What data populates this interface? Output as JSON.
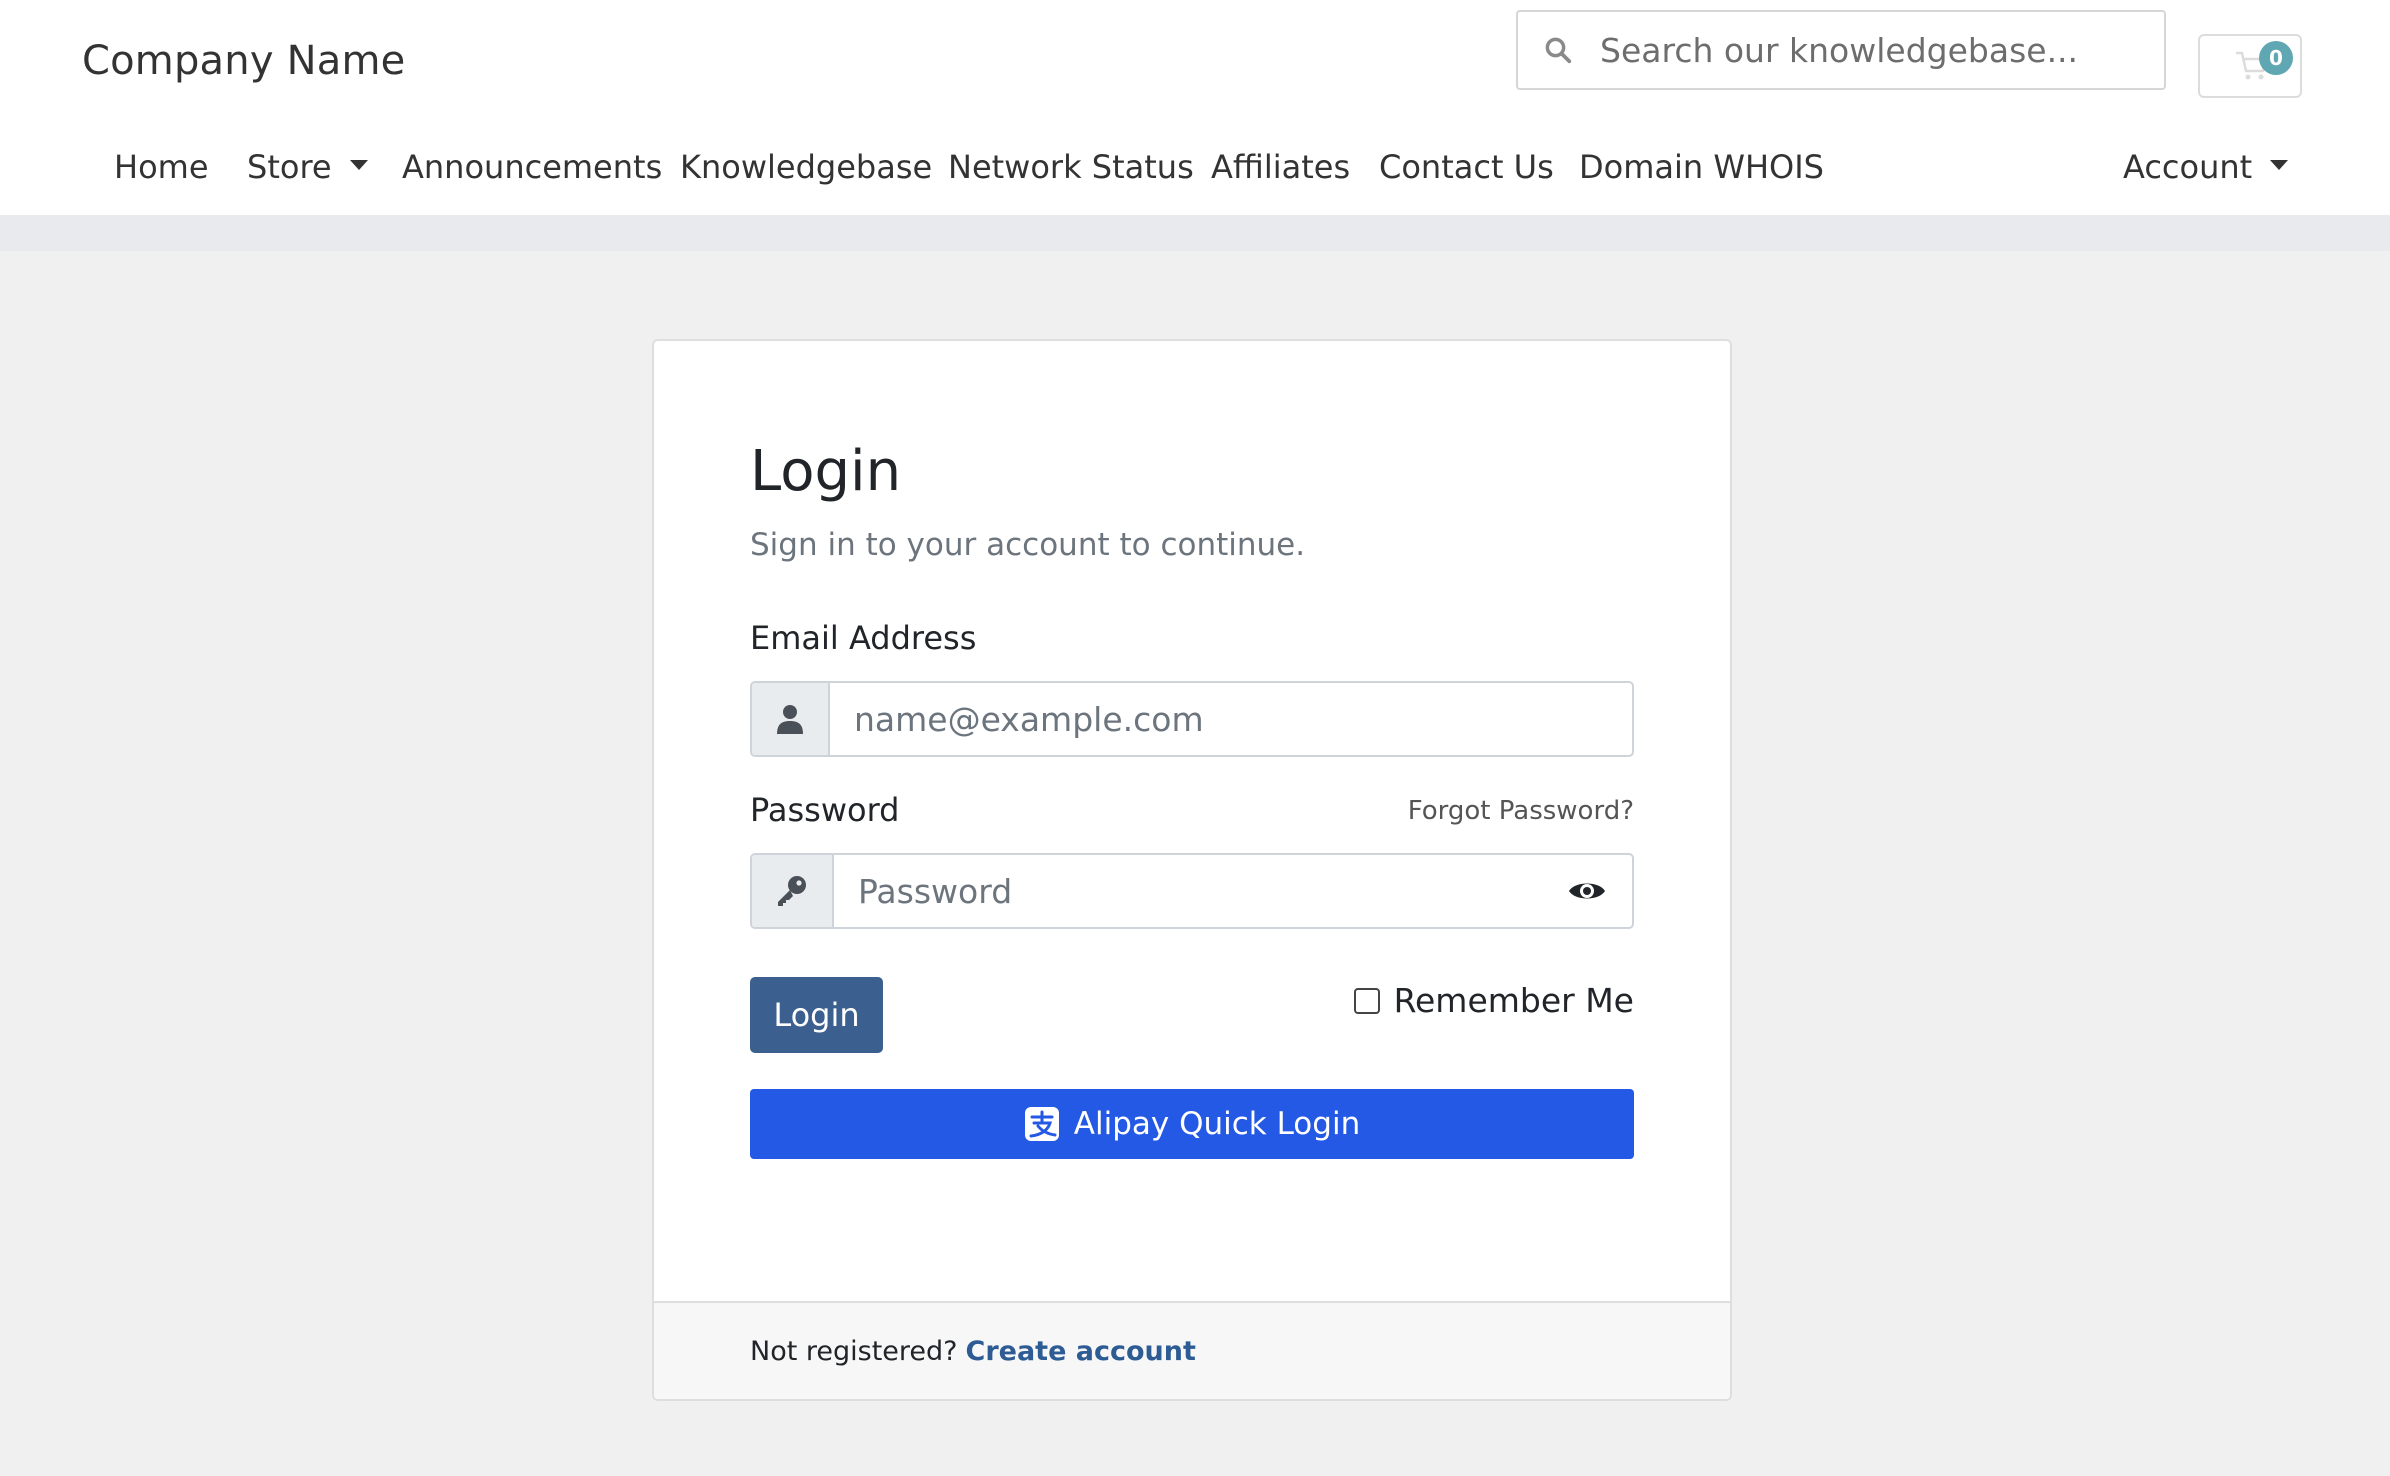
{
  "header": {
    "brand": "Company Name",
    "search": {
      "placeholder": "Search our knowledgebase..."
    },
    "cart": {
      "count": "0"
    }
  },
  "nav": {
    "items": [
      {
        "label": "Home"
      },
      {
        "label": "Store",
        "dropdown": true
      },
      {
        "label": "Announcements"
      },
      {
        "label": "Knowledgebase"
      },
      {
        "label": "Network Status"
      },
      {
        "label": "Affiliates"
      },
      {
        "label": "Contact Us"
      },
      {
        "label": "Domain WHOIS"
      }
    ],
    "account": {
      "label": "Account",
      "dropdown": true
    }
  },
  "login": {
    "title": "Login",
    "subtitle": "Sign in to your account to continue.",
    "email": {
      "label": "Email Address",
      "placeholder": "name@example.com",
      "value": ""
    },
    "password": {
      "label": "Password",
      "placeholder": "Password",
      "value": "",
      "forgot_label": "Forgot Password?"
    },
    "login_button": "Login",
    "remember_label": "Remember Me",
    "remember_checked": false,
    "alipay_button": "Alipay Quick Login",
    "footer": {
      "text": "Not registered?",
      "link": "Create account"
    }
  },
  "colors": {
    "primary": "#3b5f8f",
    "alipay": "#2459e6",
    "badge": "#5ea7b3",
    "link": "#2d5b94",
    "page_bg": "#f0f0f1"
  }
}
